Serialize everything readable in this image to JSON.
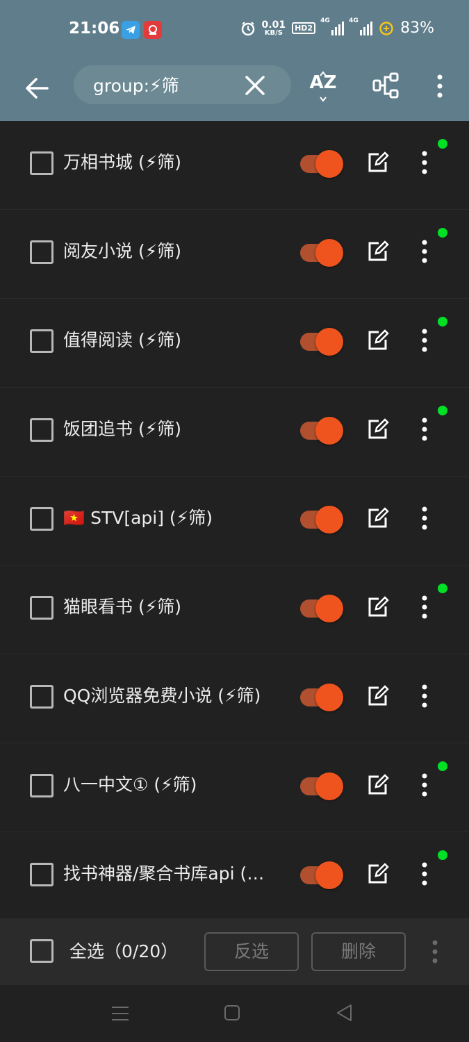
{
  "status_bar": {
    "time": "21:06",
    "net_speed_value": "0.01",
    "net_speed_unit": "KB/S",
    "hd_label": "HD2",
    "sig1_label": "4G",
    "sig2_label": "4G",
    "battery": "83%"
  },
  "toolbar": {
    "search_value": "group:⚡筛",
    "sort_label_a": "A",
    "sort_label_z": "Z"
  },
  "sources": [
    {
      "name": "万相书城 (⚡筛)",
      "enabled": true,
      "dot": true
    },
    {
      "name": "阅友小说 (⚡筛)",
      "enabled": true,
      "dot": true
    },
    {
      "name": " 值得阅读 (⚡筛)",
      "enabled": true,
      "dot": true
    },
    {
      "name": "饭团追书 (⚡筛)",
      "enabled": true,
      "dot": true
    },
    {
      "name": "🇻🇳 STV[api] (⚡筛)",
      "enabled": true,
      "dot": false
    },
    {
      "name": "猫眼看书 (⚡筛)",
      "enabled": true,
      "dot": true
    },
    {
      "name": "QQ浏览器免费小说 (⚡筛)",
      "enabled": true,
      "dot": false
    },
    {
      "name": "八一中文① (⚡筛)",
      "enabled": true,
      "dot": true
    },
    {
      "name": "找书神器/聚合书库api (⚡筛)",
      "enabled": true,
      "dot": true
    }
  ],
  "bottom_bar": {
    "select_all_label": "全选（0/20）",
    "invert_label": "反选",
    "delete_label": "删除"
  },
  "colors": {
    "header": "#607d8b",
    "accent": "#f0541e",
    "online_dot": "#00e025",
    "background": "#212121"
  }
}
